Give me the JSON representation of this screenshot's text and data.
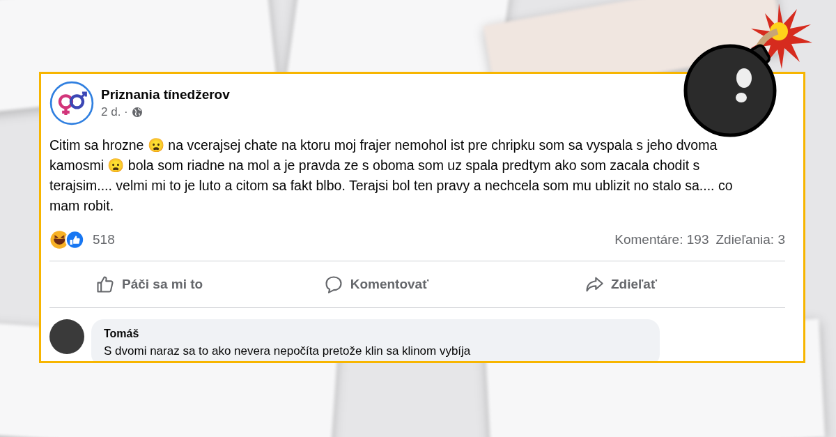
{
  "post": {
    "page_name": "Priznania tínedžerov",
    "time": "2 d. ·",
    "text": "Citim sa hrozne 😦 na vcerajsej chate na ktoru moj frajer nemohol ist pre chripku som sa vyspala s jeho dvoma kamosmi 😦 bola som riadne na mol a je pravda ze s oboma som uz spala predtym ako som zacala chodit s terajsim.... velmi mi to je luto a citom sa fakt blbo. Terajsi bol ten pravy a nechcela som mu ublizit no stalo sa.... co mam robit.",
    "reaction_count": "518",
    "comments_count": "Komentáre: 193",
    "shares_count": "Zdieľania: 3",
    "actions": [
      {
        "kind": "like",
        "label": "Páči sa mi to"
      },
      {
        "kind": "comment",
        "label": "Komentovať"
      },
      {
        "kind": "share",
        "label": "Zdieľať"
      }
    ],
    "comments": [
      {
        "author": "Tomáš",
        "text": "S dvomi naraz sa to ako nevera nepočíta pretože klin sa klinom vybíja"
      }
    ]
  }
}
